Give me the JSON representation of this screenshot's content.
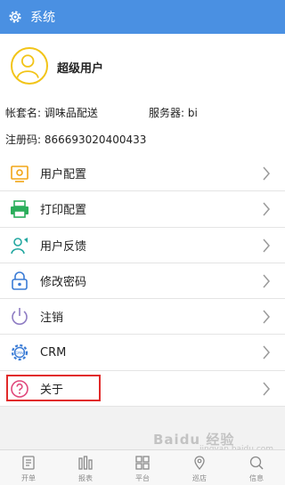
{
  "header": {
    "title": "系统"
  },
  "profile": {
    "username": "超级用户",
    "account_label": "帐套名: 调味品配送",
    "server_label": "服务器: bi",
    "reg_label": "注册码: 866693020400433"
  },
  "menu": [
    {
      "label": "用户配置",
      "icon": "user-config-icon"
    },
    {
      "label": "打印配置",
      "icon": "printer-icon"
    },
    {
      "label": "用户反馈",
      "icon": "feedback-icon"
    },
    {
      "label": "修改密码",
      "icon": "lock-icon"
    },
    {
      "label": "注销",
      "icon": "power-icon"
    },
    {
      "label": "CRM",
      "icon": "crm-icon"
    },
    {
      "label": "关于",
      "icon": "question-icon"
    }
  ],
  "tabs": [
    {
      "label": "开单",
      "icon": "order-icon"
    },
    {
      "label": "报表",
      "icon": "report-icon"
    },
    {
      "label": "平台",
      "icon": "grid-icon"
    },
    {
      "label": "巡店",
      "icon": "location-icon"
    },
    {
      "label": "信息",
      "icon": "search-icon"
    }
  ],
  "watermark": {
    "brand": "Baidu 经验",
    "sub": "jingyan.baidu.com"
  },
  "colors": {
    "header": "#4a90e2",
    "highlight": "#e12a2a",
    "avatar": "#f2c418"
  }
}
